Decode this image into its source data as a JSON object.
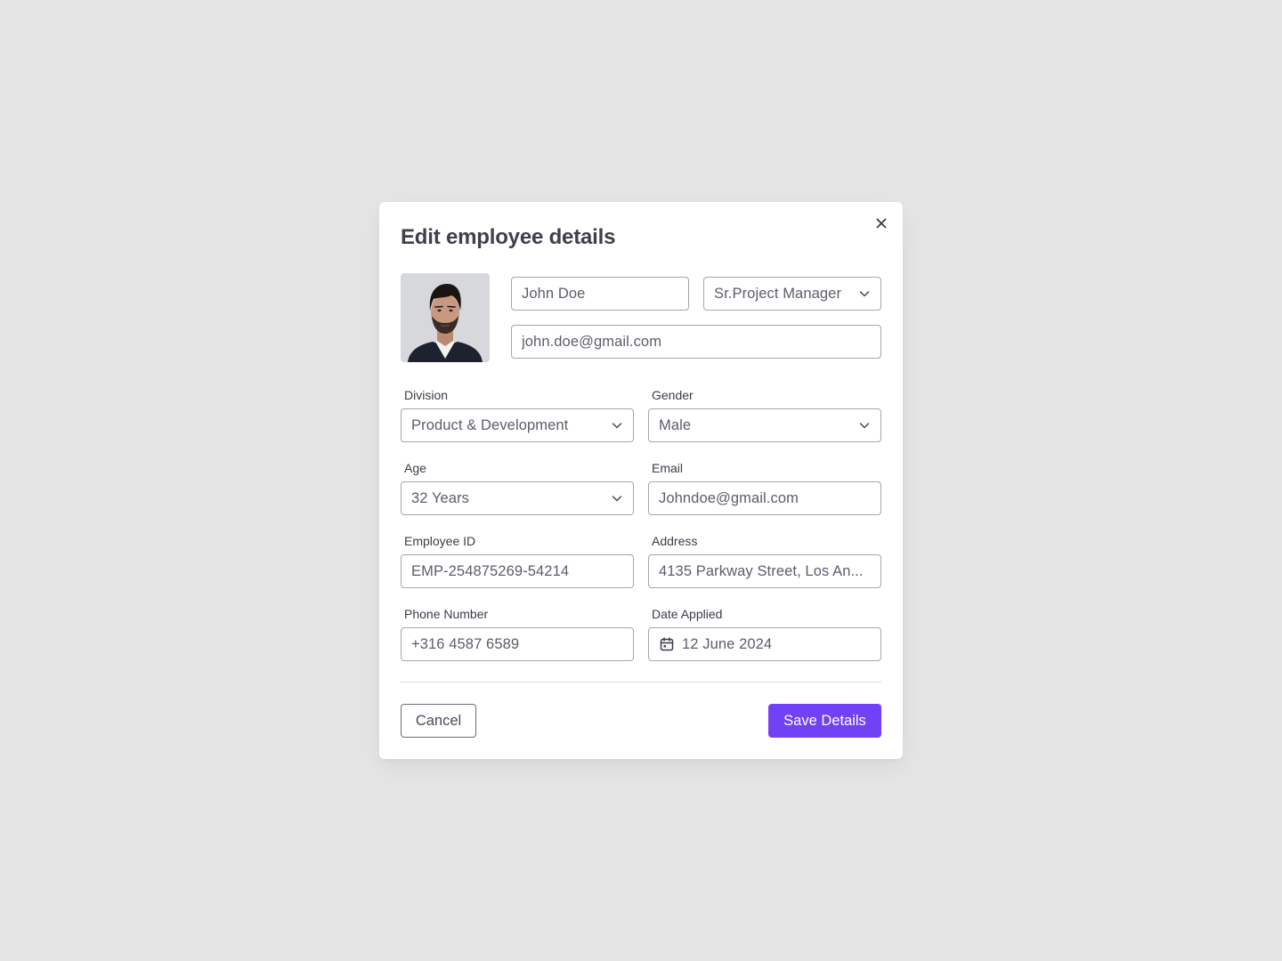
{
  "modal": {
    "title": "Edit employee details",
    "close_icon": "close-icon"
  },
  "profile": {
    "avatar": "employee-photo",
    "name": "John Doe",
    "role": "Sr.Project Manager",
    "email": "john.doe@gmail.com"
  },
  "form": {
    "division": {
      "label": "Division",
      "value": "Product & Development"
    },
    "gender": {
      "label": "Gender",
      "value": "Male"
    },
    "age": {
      "label": "Age",
      "value": "32 Years"
    },
    "email": {
      "label": "Email",
      "value": "Johndoe@gmail.com"
    },
    "employee_id": {
      "label": "Employee ID",
      "value": "EMP-254875269-54214"
    },
    "address": {
      "label": "Address",
      "value": "4135 Parkway Street, Los An..."
    },
    "phone": {
      "label": "Phone Number",
      "value": "+316 4587 6589"
    },
    "date_applied": {
      "label": "Date Applied",
      "value": "12 June 2024",
      "icon": "calendar-icon"
    }
  },
  "actions": {
    "cancel_label": "Cancel",
    "save_label": "Save Details"
  },
  "colors": {
    "background": "#e5e5e6",
    "accent": "#7141f6",
    "border": "#a4a6ad"
  }
}
